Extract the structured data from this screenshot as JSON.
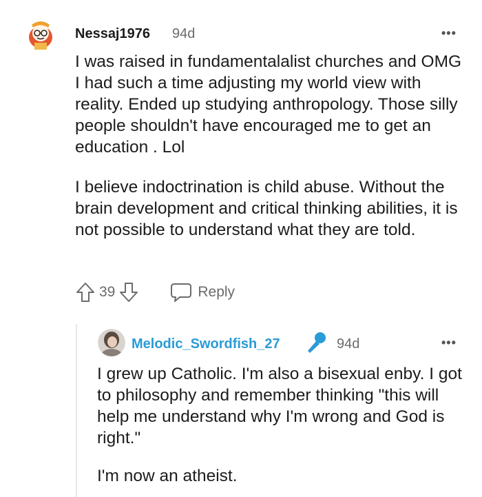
{
  "comment": {
    "username": "Nessaj1976",
    "time": "94d",
    "more_label": "•••",
    "paragraphs": [
      "I was raised in fundamentalalist churches and OMG I had such a time adjusting my world view with reality. Ended up studying anthropology. Those silly people shouldn't have encouraged me to get an education . Lol",
      "I believe indoctrination is child abuse. Without the brain development and critical thinking abilities, it is not possible to understand what they are told."
    ],
    "votes": "39",
    "reply_label": "Reply"
  },
  "reply": {
    "username": "Melodic_Swordfish_27",
    "username_color": "#2a9bd6",
    "time": "94d",
    "more_label": "•••",
    "paragraphs": [
      "I grew up Catholic. I'm also a bisexual enby. I got to philosophy and remember thinking \"this will help me understand why I'm wrong and God is right.\"",
      "I'm now an atheist."
    ]
  }
}
